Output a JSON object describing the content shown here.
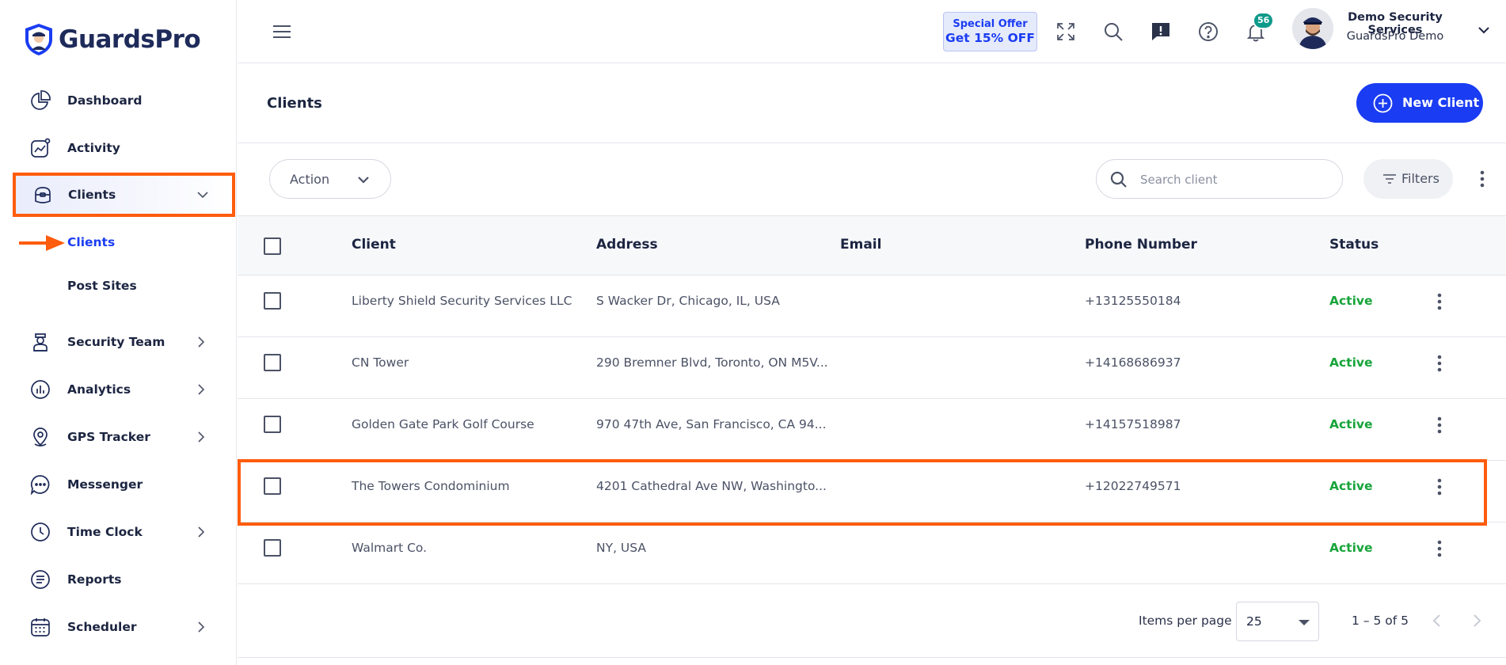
{
  "app": {
    "logo_text": "GuardsPro"
  },
  "sidebar": {
    "items": [
      {
        "label": "Dashboard"
      },
      {
        "label": "Activity"
      },
      {
        "label": "Clients"
      },
      {
        "label": "Security Team"
      },
      {
        "label": "Analytics"
      },
      {
        "label": "GPS Tracker"
      },
      {
        "label": "Messenger"
      },
      {
        "label": "Time Clock"
      },
      {
        "label": "Reports"
      },
      {
        "label": "Scheduler"
      }
    ],
    "clients_subitems": [
      {
        "label": "Clients",
        "current": true
      },
      {
        "label": "Post Sites",
        "current": false
      }
    ]
  },
  "topbar": {
    "offer_line1": "Special Offer",
    "offer_line2": "Get 15% OFF",
    "notification_count": "56",
    "user_name": "Demo Security Services",
    "user_org": "GuardsPro Demo"
  },
  "page": {
    "title": "Clients",
    "new_button": "New Client"
  },
  "toolbar": {
    "action_label": "Action",
    "search_placeholder": "Search client",
    "filters_label": "Filters"
  },
  "table": {
    "columns": [
      "Client",
      "Address",
      "Email",
      "Phone Number",
      "Status"
    ],
    "rows": [
      {
        "client": "Liberty Shield Security Services LLC",
        "address": "S Wacker Dr, Chicago, IL, USA",
        "email": "",
        "phone": "+13125550184",
        "status": "Active"
      },
      {
        "client": "CN Tower",
        "address": "290 Bremner Blvd, Toronto, ON M5V...",
        "email": "",
        "phone": "+14168686937",
        "status": "Active"
      },
      {
        "client": "Golden Gate Park Golf Course",
        "address": "970 47th Ave, San Francisco, CA 94...",
        "email": "",
        "phone": "+14157518987",
        "status": "Active"
      },
      {
        "client": "The Towers Condominium",
        "address": "4201 Cathedral Ave NW, Washingto...",
        "email": "",
        "phone": "+12022749571",
        "status": "Active"
      },
      {
        "client": "Walmart Co.",
        "address": "NY, USA",
        "email": "",
        "phone": "",
        "status": "Active"
      }
    ]
  },
  "pagination": {
    "items_per_page_label": "Items per page",
    "items_per_page_value": "25",
    "range": "1 – 5 of 5"
  },
  "colors": {
    "accent": "#1a3cf2",
    "highlight": "#ff5c0d",
    "status_active": "#17a43a",
    "badge": "#0e9a8a"
  }
}
